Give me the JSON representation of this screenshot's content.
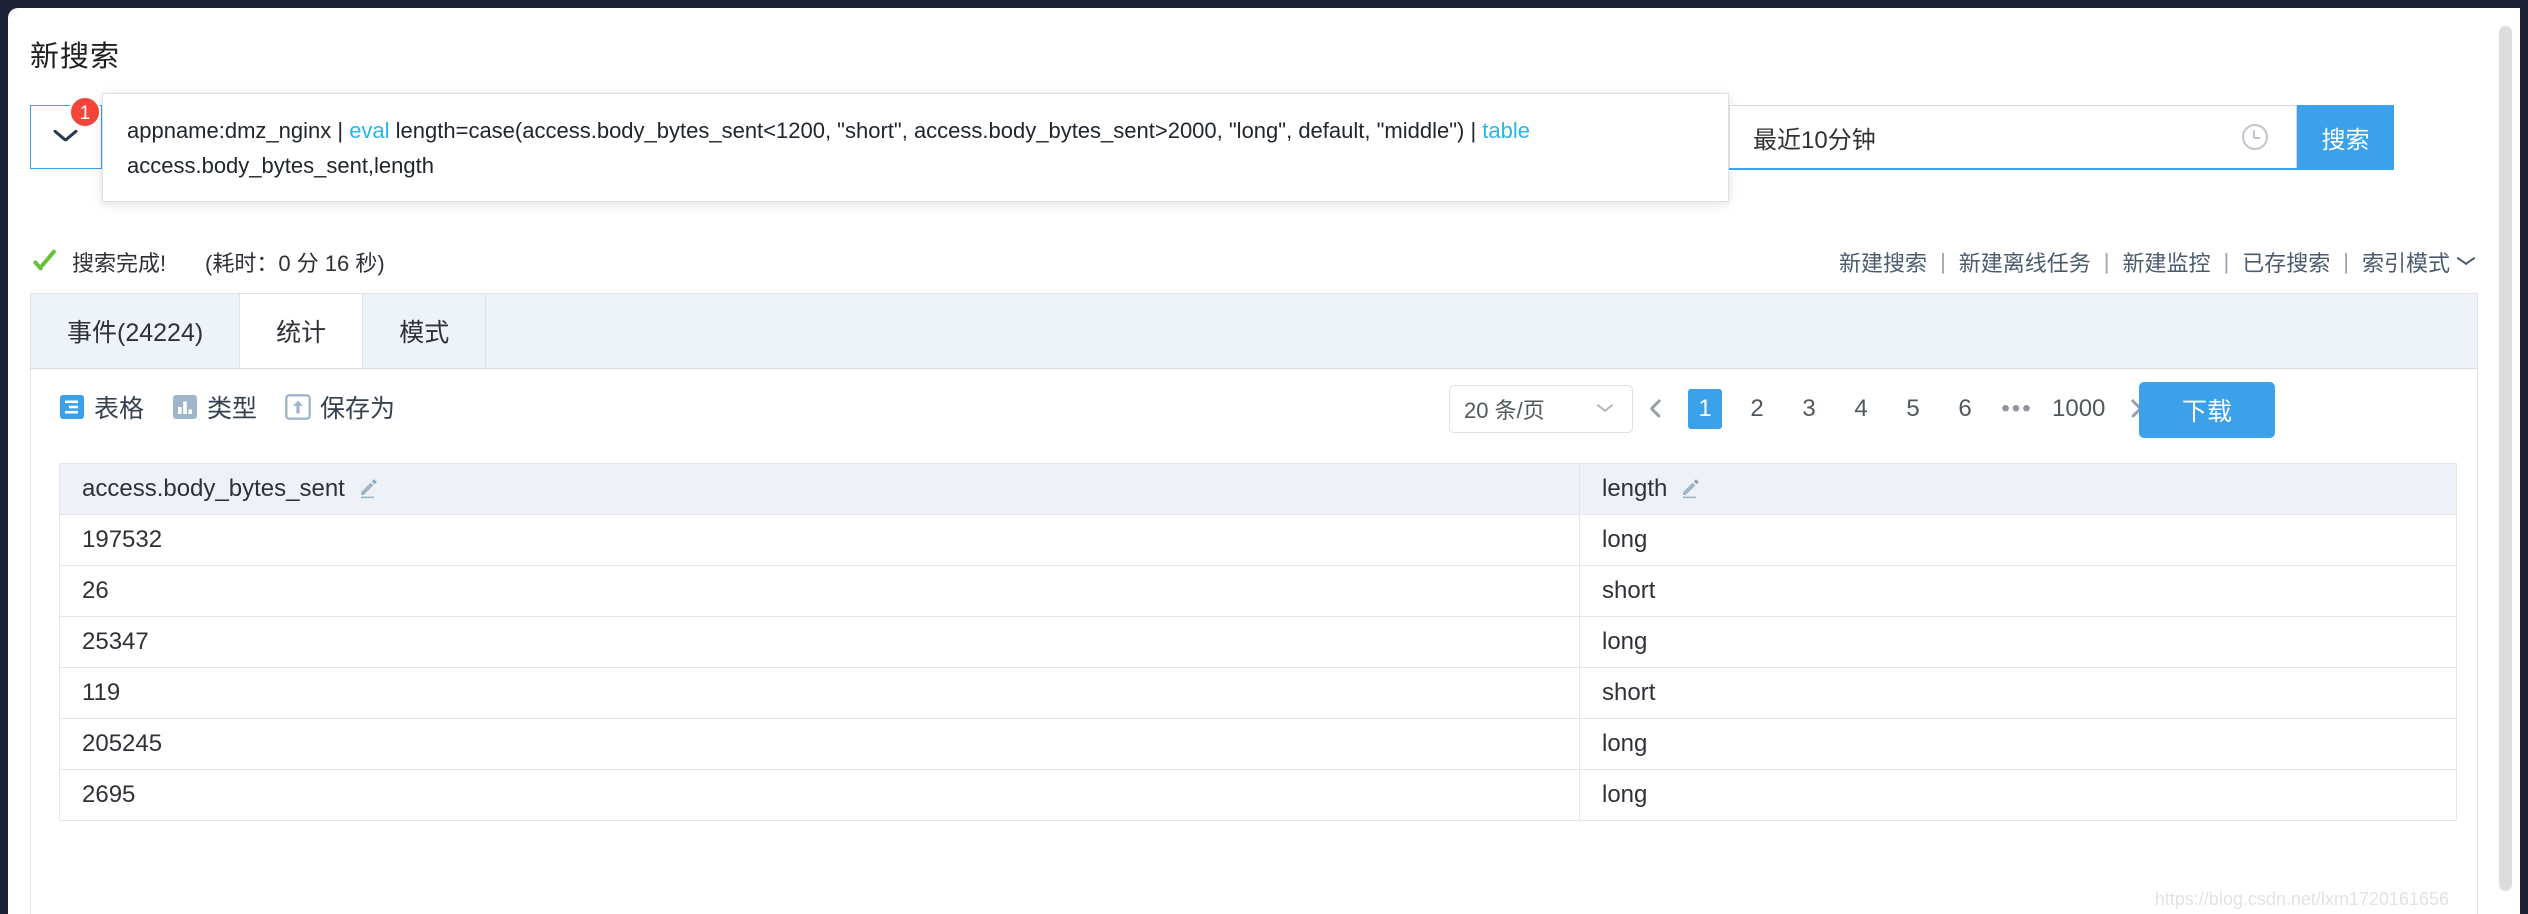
{
  "page": {
    "title": "新搜索"
  },
  "search": {
    "badge_count": "1",
    "expand_icon": "chevron-down-icon",
    "query_parts": [
      {
        "text": "appname:dmz_nginx | ",
        "kind": "plain"
      },
      {
        "text": "eval",
        "kind": "keyword"
      },
      {
        "text": " length=case(access.body_bytes_sent<1200, \"short\", access.body_bytes_sent>2000, \"long\", default, \"middle\") | ",
        "kind": "plain"
      },
      {
        "text": "table",
        "kind": "keyword"
      },
      {
        "text": " access.body_bytes_sent,length",
        "kind": "plain"
      }
    ],
    "query_plain": "appname:dmz_nginx | eval length=case(access.body_bytes_sent<1200, \"short\", access.body_bytes_sent>2000, \"long\", default, \"middle\") | table access.body_bytes_sent,length",
    "time_range": "最近10分钟",
    "time_icon": "clock-icon",
    "search_button": "搜索"
  },
  "status": {
    "icon": "check-icon",
    "message": "搜索完成!",
    "elapsed": "(耗时：0 分 16 秒)"
  },
  "actions": {
    "items": [
      {
        "label": "新建搜索",
        "name": "new-search-link"
      },
      {
        "label": "新建离线任务",
        "name": "new-offline-task-link"
      },
      {
        "label": "新建监控",
        "name": "new-monitor-link"
      },
      {
        "label": "已存搜索",
        "name": "saved-searches-link"
      }
    ],
    "separator": "|",
    "mode_label": "索引模式"
  },
  "tabs": [
    {
      "label": "事件(24224)",
      "name": "tab-events",
      "active": false
    },
    {
      "label": "统计",
      "name": "tab-statistics",
      "active": true
    },
    {
      "label": "模式",
      "name": "tab-patterns",
      "active": false
    }
  ],
  "toolbar": {
    "items": [
      {
        "label": "表格",
        "icon": "table-icon",
        "name": "toolbar-table"
      },
      {
        "label": "类型",
        "icon": "chart-bar-icon",
        "name": "toolbar-chart-type"
      },
      {
        "label": "保存为",
        "icon": "save-as-icon",
        "name": "toolbar-save-as"
      }
    ]
  },
  "pagination": {
    "page_size": "20 条/页",
    "prev_icon": "chevron-left-icon",
    "next_icon": "chevron-right-icon",
    "pages": [
      "1",
      "2",
      "3",
      "4",
      "5",
      "6"
    ],
    "ellipsis": "•••",
    "last_page": "1000",
    "current_page": "1"
  },
  "download": {
    "label": "下载"
  },
  "table": {
    "columns": [
      {
        "label": "access.body_bytes_sent",
        "edit_icon": "pencil-icon",
        "name": "column-header-body-bytes-sent"
      },
      {
        "label": "length",
        "edit_icon": "pencil-icon",
        "name": "column-header-length"
      }
    ],
    "rows": [
      {
        "c1": "197532",
        "c2": "long"
      },
      {
        "c1": "26",
        "c2": "short"
      },
      {
        "c1": "25347",
        "c2": "long"
      },
      {
        "c1": "119",
        "c2": "short"
      },
      {
        "c1": "205245",
        "c2": "long"
      },
      {
        "c1": "2695",
        "c2": "long"
      }
    ]
  },
  "watermark": {
    "text": "https://blog.csdn.net/lxm1720161656"
  },
  "colors": {
    "accent": "#3ba1ea",
    "keyword": "#29b6e8",
    "badge": "#f5443a",
    "success": "#67c23a",
    "tabbar_bg": "#eef2f9",
    "header_bg": "#eef2f7",
    "frame": "#1c2135"
  }
}
